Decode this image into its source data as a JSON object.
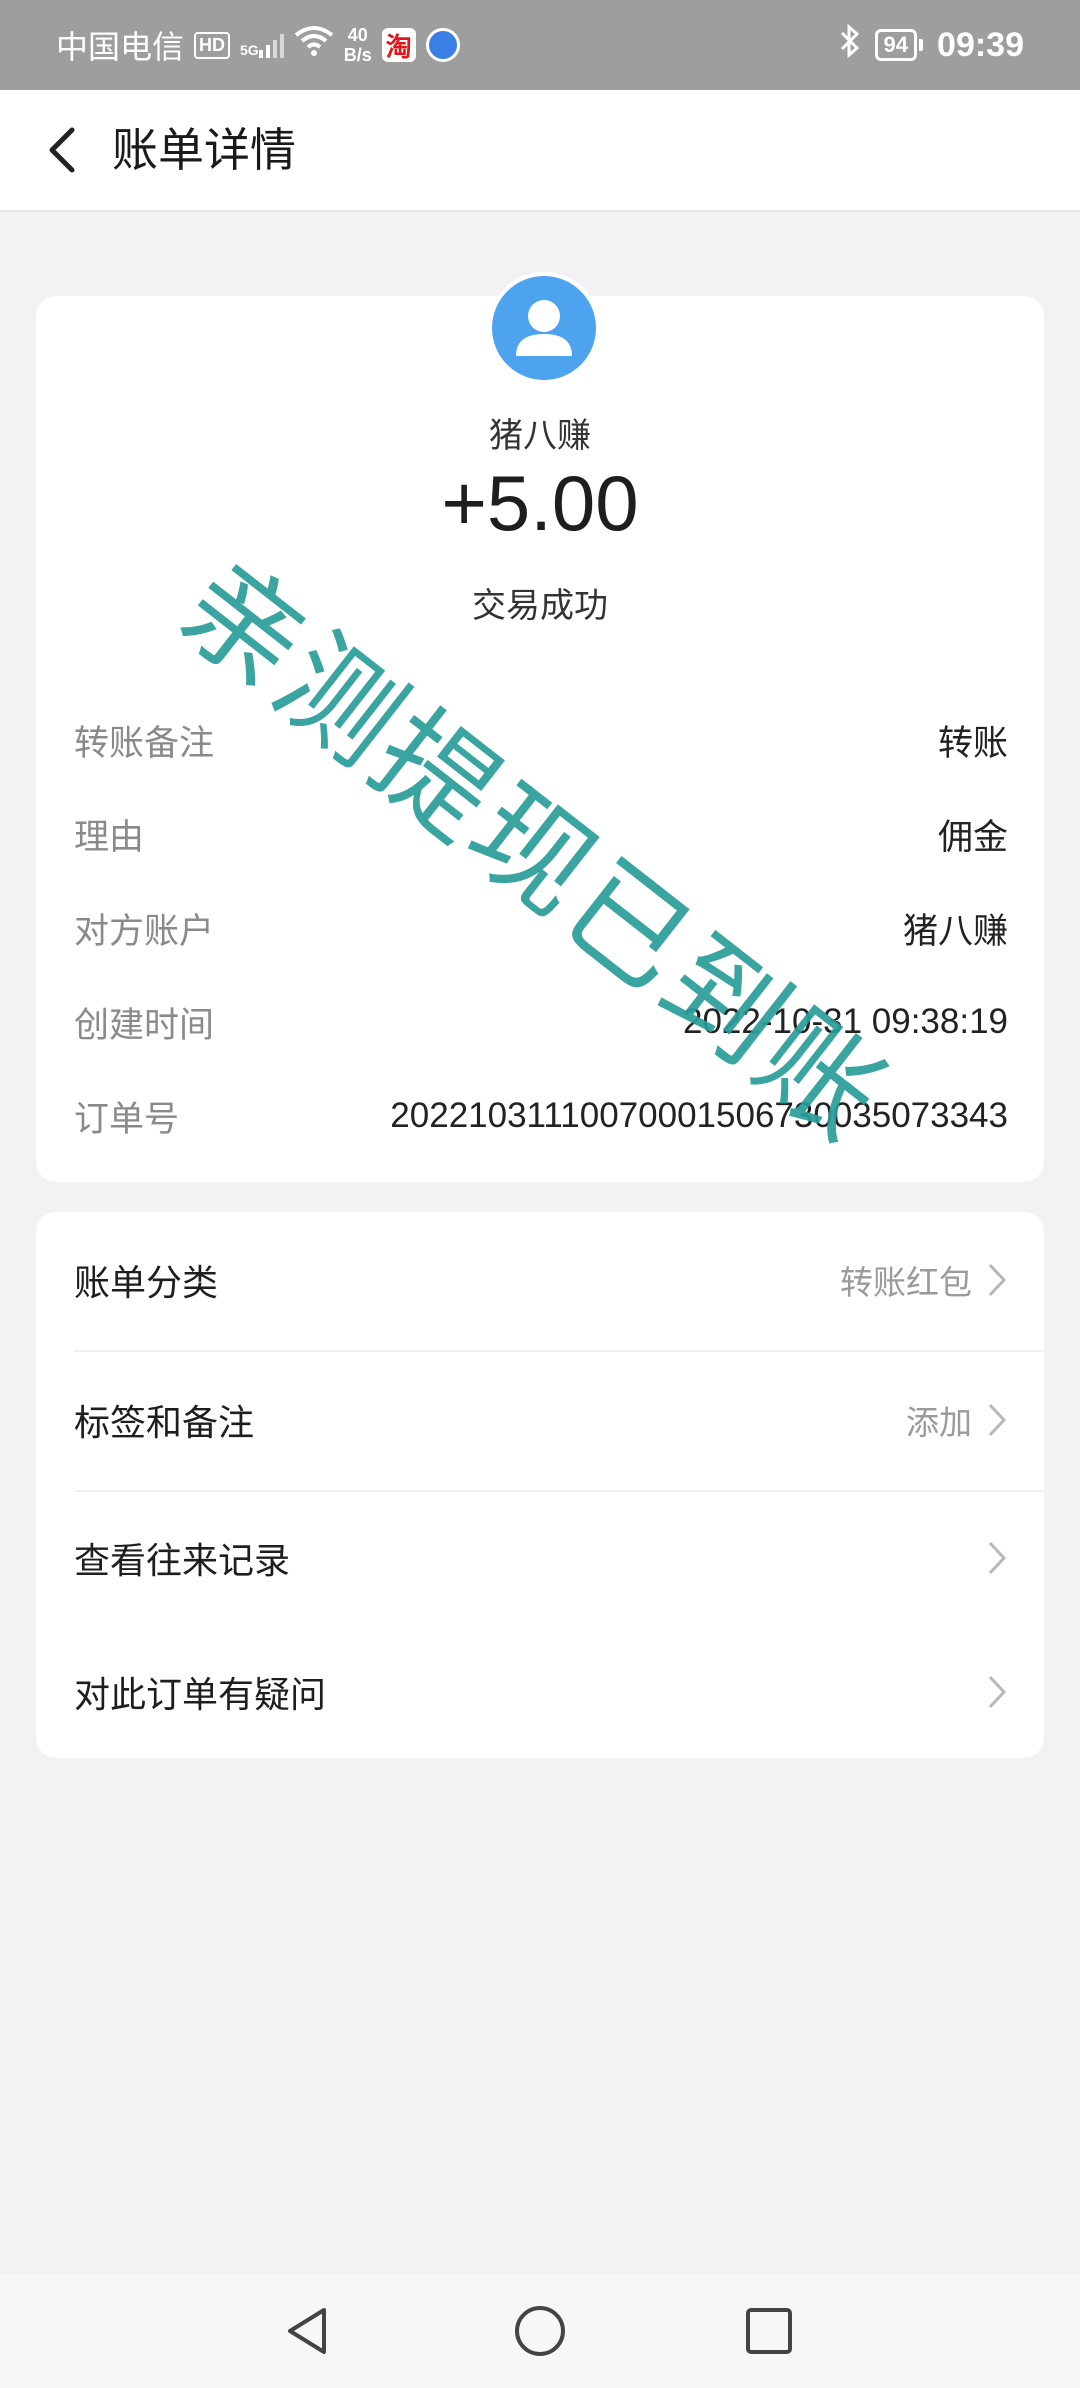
{
  "status_bar": {
    "carrier": "中国电信",
    "hd_badge": "HD",
    "network_tag": "5G",
    "speed_value": "40",
    "speed_unit": "B/s",
    "taobao_char": "淘",
    "battery": "94",
    "time": "09:39"
  },
  "header": {
    "title": "账单详情"
  },
  "summary": {
    "payer_name": "猪八赚",
    "amount": "+5.00",
    "status": "交易成功",
    "rows": [
      {
        "label": "转账备注",
        "value": "转账"
      },
      {
        "label": "理由",
        "value": "佣金"
      },
      {
        "label": "对方账户",
        "value": "猪八赚"
      },
      {
        "label": "创建时间",
        "value": "2022-10-31 09:38:19"
      },
      {
        "label": "订单号",
        "value": "20221031110070001506730035073343"
      }
    ]
  },
  "menu": {
    "items": [
      {
        "label": "账单分类",
        "value": "转账红包"
      },
      {
        "label": "标签和备注",
        "value": "添加"
      },
      {
        "label": "查看往来记录",
        "value": ""
      },
      {
        "label": "对此订单有疑问",
        "value": ""
      }
    ]
  },
  "watermark": {
    "text": "亲测提现已到账"
  },
  "colors": {
    "status_bar": "#9e9e9e",
    "avatar": "#4da3ee",
    "watermark": "#2a9d9a",
    "background": "#f2f2f4"
  },
  "icons": {
    "back": "chevron-left-icon",
    "avatar": "user-icon",
    "menu_arrow": "chevron-right-icon",
    "nav_back": "triangle-back-icon",
    "nav_home": "circle-home-icon",
    "nav_recent": "square-recent-icon"
  }
}
